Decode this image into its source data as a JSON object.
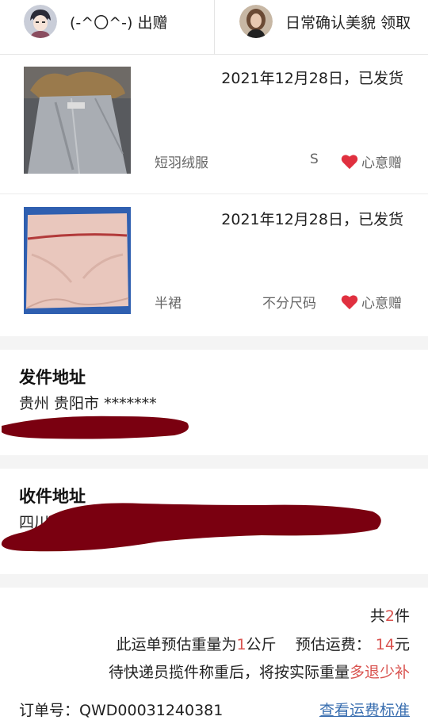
{
  "header": {
    "giver": {
      "name": "(-^〇^-)",
      "action": "出赠"
    },
    "receiver": {
      "name": "日常确认美貌",
      "action": "领取"
    }
  },
  "items": [
    {
      "date": "2021年12月28日，已发货",
      "name": "短羽绒服",
      "size": "S",
      "tag": "心意赠"
    },
    {
      "date": "2021年12月28日，已发货",
      "name": "半裙",
      "size": "不分尺码",
      "tag": "心意赠"
    }
  ],
  "sender_address": {
    "title": "发件地址",
    "line": "贵州 贵阳市 *******"
  },
  "receiver_address": {
    "title": "收件地址",
    "line": "四川"
  },
  "summary": {
    "count_prefix": "共",
    "count": "2",
    "count_suffix": "件",
    "weight_prefix": "此运单预估重量为",
    "weight": "1",
    "weight_unit": "公斤",
    "fee_prefix": "预估运费：",
    "fee": "14",
    "fee_unit": "元",
    "note_prefix": "待快递员揽件称重后，将按实际重量",
    "note_highlight": "多退少补",
    "order_label": "订单号：",
    "order_no": "QWD00031240381",
    "fee_standard_link": "查看运费标准"
  },
  "colors": {
    "heart": "#e0303f",
    "highlight": "#d9534f",
    "link": "#3a6fb0",
    "redaction": "#7a0010"
  }
}
